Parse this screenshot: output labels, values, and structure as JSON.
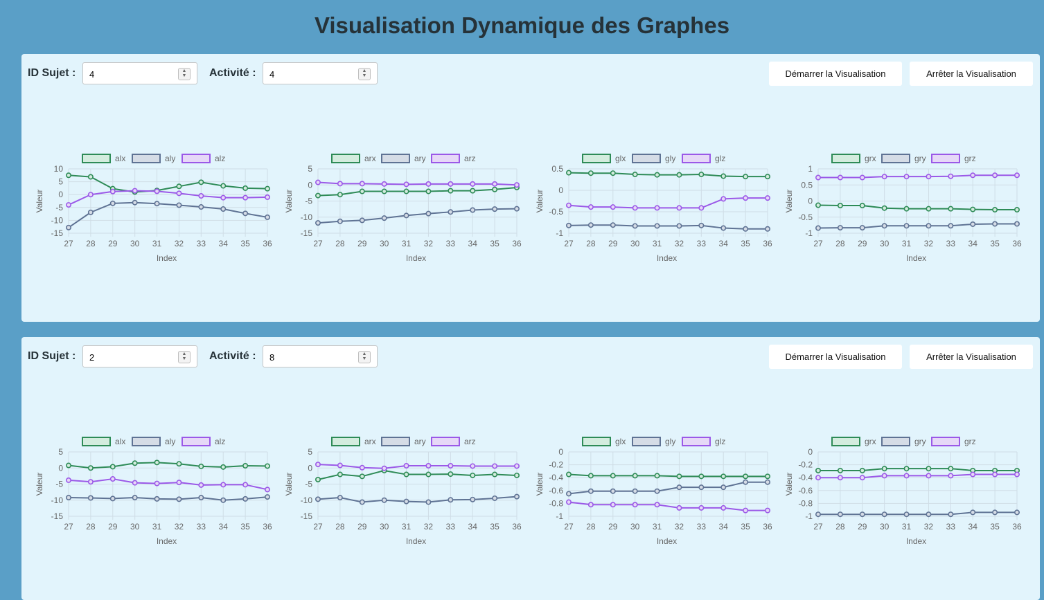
{
  "page_title": "Visualisation Dynamique des Graphes",
  "colors": {
    "green": "#2e8b57",
    "slate": "#5f7394",
    "purple": "#9b59e8",
    "grid": "#cfdde6",
    "page_bg": "#5a9fc7",
    "panel_bg": "#e2f4fc"
  },
  "panels": [
    {
      "subject_label": "ID Sujet :",
      "subject_value": "4",
      "activity_label": "Activité :",
      "activity_value": "4",
      "start_label": "Démarrer la Visualisation",
      "stop_label": "Arrêter la Visualisation",
      "chart_data": [
        {
          "type": "line",
          "xlabel": "Index",
          "ylabel": "Valeur",
          "x": [
            27,
            28,
            29,
            30,
            31,
            32,
            33,
            34,
            35,
            36
          ],
          "ylim": [
            -15,
            10
          ],
          "yticks": [
            10,
            5,
            0,
            -5,
            -10,
            -15
          ],
          "series": [
            {
              "name": "alx",
              "values": [
                7.5,
                6.9,
                2.3,
                1,
                1.6,
                3.2,
                4.8,
                3.4,
                2.5,
                2.3
              ]
            },
            {
              "name": "aly",
              "values": [
                -12.8,
                -6.9,
                -3.4,
                -3.1,
                -3.5,
                -4.1,
                -4.8,
                -5.6,
                -7.3,
                -8.8
              ]
            },
            {
              "name": "alz",
              "values": [
                -4,
                0,
                1.2,
                1.5,
                1.3,
                0.5,
                -0.5,
                -1.2,
                -1.2,
                -1
              ]
            }
          ]
        },
        {
          "type": "line",
          "xlabel": "Index",
          "ylabel": "Valeur",
          "x": [
            27,
            28,
            29,
            30,
            31,
            32,
            33,
            34,
            35,
            36
          ],
          "ylim": [
            -15,
            5
          ],
          "yticks": [
            5,
            0,
            -5,
            -10,
            -15
          ],
          "series": [
            {
              "name": "arx",
              "values": [
                -3.3,
                -3,
                -2,
                -2,
                -2,
                -2,
                -1.8,
                -1.8,
                -1.4,
                -0.8
              ]
            },
            {
              "name": "ary",
              "values": [
                -11.8,
                -11.3,
                -11,
                -10.3,
                -9.5,
                -8.9,
                -8.4,
                -7.8,
                -7.5,
                -7.4
              ]
            },
            {
              "name": "arz",
              "values": [
                0.8,
                0.4,
                0.4,
                0.3,
                0.2,
                0.3,
                0.3,
                0.3,
                0.3,
                0
              ]
            }
          ]
        },
        {
          "type": "line",
          "xlabel": "Index",
          "ylabel": "Valeur",
          "x": [
            27,
            28,
            29,
            30,
            31,
            32,
            33,
            34,
            35,
            36
          ],
          "ylim": [
            -1,
            0.5
          ],
          "yticks": [
            0.5,
            0,
            -0.5,
            -1.0
          ],
          "series": [
            {
              "name": "glx",
              "values": [
                0.41,
                0.4,
                0.4,
                0.37,
                0.36,
                0.36,
                0.37,
                0.33,
                0.32,
                0.32
              ]
            },
            {
              "name": "gly",
              "values": [
                -0.82,
                -0.81,
                -0.81,
                -0.83,
                -0.83,
                -0.83,
                -0.82,
                -0.88,
                -0.9,
                -0.9
              ]
            },
            {
              "name": "glz",
              "values": [
                -0.35,
                -0.39,
                -0.39,
                -0.41,
                -0.41,
                -0.41,
                -0.41,
                -0.2,
                -0.18,
                -0.18
              ]
            }
          ]
        },
        {
          "type": "line",
          "xlabel": "Index",
          "ylabel": "Valeur",
          "x": [
            27,
            28,
            29,
            30,
            31,
            32,
            33,
            34,
            35,
            36
          ],
          "ylim": [
            -1,
            1
          ],
          "yticks": [
            1.0,
            0.5,
            0,
            -0.5,
            -1.0
          ],
          "series": [
            {
              "name": "grx",
              "values": [
                -0.13,
                -0.14,
                -0.14,
                -0.22,
                -0.24,
                -0.24,
                -0.24,
                -0.26,
                -0.27,
                -0.27
              ]
            },
            {
              "name": "gry",
              "values": [
                -0.84,
                -0.83,
                -0.83,
                -0.77,
                -0.77,
                -0.77,
                -0.77,
                -0.72,
                -0.71,
                -0.71
              ]
            },
            {
              "name": "grz",
              "values": [
                0.73,
                0.73,
                0.73,
                0.76,
                0.76,
                0.76,
                0.77,
                0.8,
                0.8,
                0.8
              ]
            }
          ]
        }
      ]
    },
    {
      "subject_label": "ID Sujet :",
      "subject_value": "2",
      "activity_label": "Activité :",
      "activity_value": "8",
      "start_label": "Démarrer la Visualisation",
      "stop_label": "Arrêter la Visualisation",
      "chart_data": [
        {
          "type": "line",
          "xlabel": "Index",
          "ylabel": "Valeur",
          "x": [
            27,
            28,
            29,
            30,
            31,
            32,
            33,
            34,
            35,
            36
          ],
          "ylim": [
            -15,
            5
          ],
          "yticks": [
            5,
            0,
            -5,
            -10,
            -15
          ],
          "series": [
            {
              "name": "alx",
              "values": [
                0.8,
                0,
                0.4,
                1.5,
                1.7,
                1.3,
                0.5,
                0.3,
                0.7,
                0.6
              ]
            },
            {
              "name": "aly",
              "values": [
                -9.2,
                -9.3,
                -9.5,
                -9.2,
                -9.6,
                -9.7,
                -9.2,
                -10,
                -9.6,
                -9
              ]
            },
            {
              "name": "alz",
              "values": [
                -3.8,
                -4.3,
                -3.4,
                -4.6,
                -4.8,
                -4.5,
                -5.3,
                -5.2,
                -5.2,
                -6.7
              ]
            }
          ]
        },
        {
          "type": "line",
          "xlabel": "Index",
          "ylabel": "Valeur",
          "x": [
            27,
            28,
            29,
            30,
            31,
            32,
            33,
            34,
            35,
            36
          ],
          "ylim": [
            -15,
            5
          ],
          "yticks": [
            5,
            0,
            -5,
            -10,
            -15
          ],
          "series": [
            {
              "name": "arx",
              "values": [
                -3.6,
                -2,
                -2.6,
                -0.8,
                -2,
                -2,
                -1.9,
                -2.3,
                -2,
                -2.3
              ]
            },
            {
              "name": "ary",
              "values": [
                -9.7,
                -9.2,
                -10.6,
                -10,
                -10.4,
                -10.6,
                -9.9,
                -9.8,
                -9.4,
                -8.9
              ]
            },
            {
              "name": "arz",
              "values": [
                1.1,
                0.8,
                0.1,
                -0.1,
                0.7,
                0.7,
                0.7,
                0.6,
                0.6,
                0.6
              ]
            }
          ]
        },
        {
          "type": "line",
          "xlabel": "Index",
          "ylabel": "Valeur",
          "x": [
            27,
            28,
            29,
            30,
            31,
            32,
            33,
            34,
            35,
            36
          ],
          "ylim": [
            -1,
            0
          ],
          "yticks": [
            0,
            -0.2,
            -0.4,
            -0.6,
            -0.8,
            -1.0
          ],
          "series": [
            {
              "name": "glx",
              "values": [
                -0.35,
                -0.37,
                -0.37,
                -0.37,
                -0.37,
                -0.38,
                -0.38,
                -0.38,
                -0.38,
                -0.38
              ]
            },
            {
              "name": "gly",
              "values": [
                -0.65,
                -0.61,
                -0.61,
                -0.61,
                -0.61,
                -0.55,
                -0.55,
                -0.55,
                -0.47,
                -0.47
              ]
            },
            {
              "name": "glz",
              "values": [
                -0.78,
                -0.82,
                -0.82,
                -0.82,
                -0.82,
                -0.87,
                -0.87,
                -0.87,
                -0.91,
                -0.91
              ]
            }
          ]
        },
        {
          "type": "line",
          "xlabel": "Index",
          "ylabel": "Valeur",
          "x": [
            27,
            28,
            29,
            30,
            31,
            32,
            33,
            34,
            35,
            36
          ],
          "ylim": [
            -1,
            0
          ],
          "yticks": [
            0,
            -0.2,
            -0.4,
            -0.6,
            -0.8,
            -1.0
          ],
          "series": [
            {
              "name": "grx",
              "values": [
                -0.29,
                -0.29,
                -0.29,
                -0.26,
                -0.26,
                -0.26,
                -0.26,
                -0.29,
                -0.29,
                -0.29
              ]
            },
            {
              "name": "gry",
              "values": [
                -0.97,
                -0.97,
                -0.97,
                -0.97,
                -0.97,
                -0.97,
                -0.97,
                -0.94,
                -0.94,
                -0.94
              ]
            },
            {
              "name": "grz",
              "values": [
                -0.4,
                -0.4,
                -0.4,
                -0.37,
                -0.37,
                -0.37,
                -0.37,
                -0.35,
                -0.35,
                -0.35
              ]
            }
          ]
        }
      ]
    }
  ]
}
